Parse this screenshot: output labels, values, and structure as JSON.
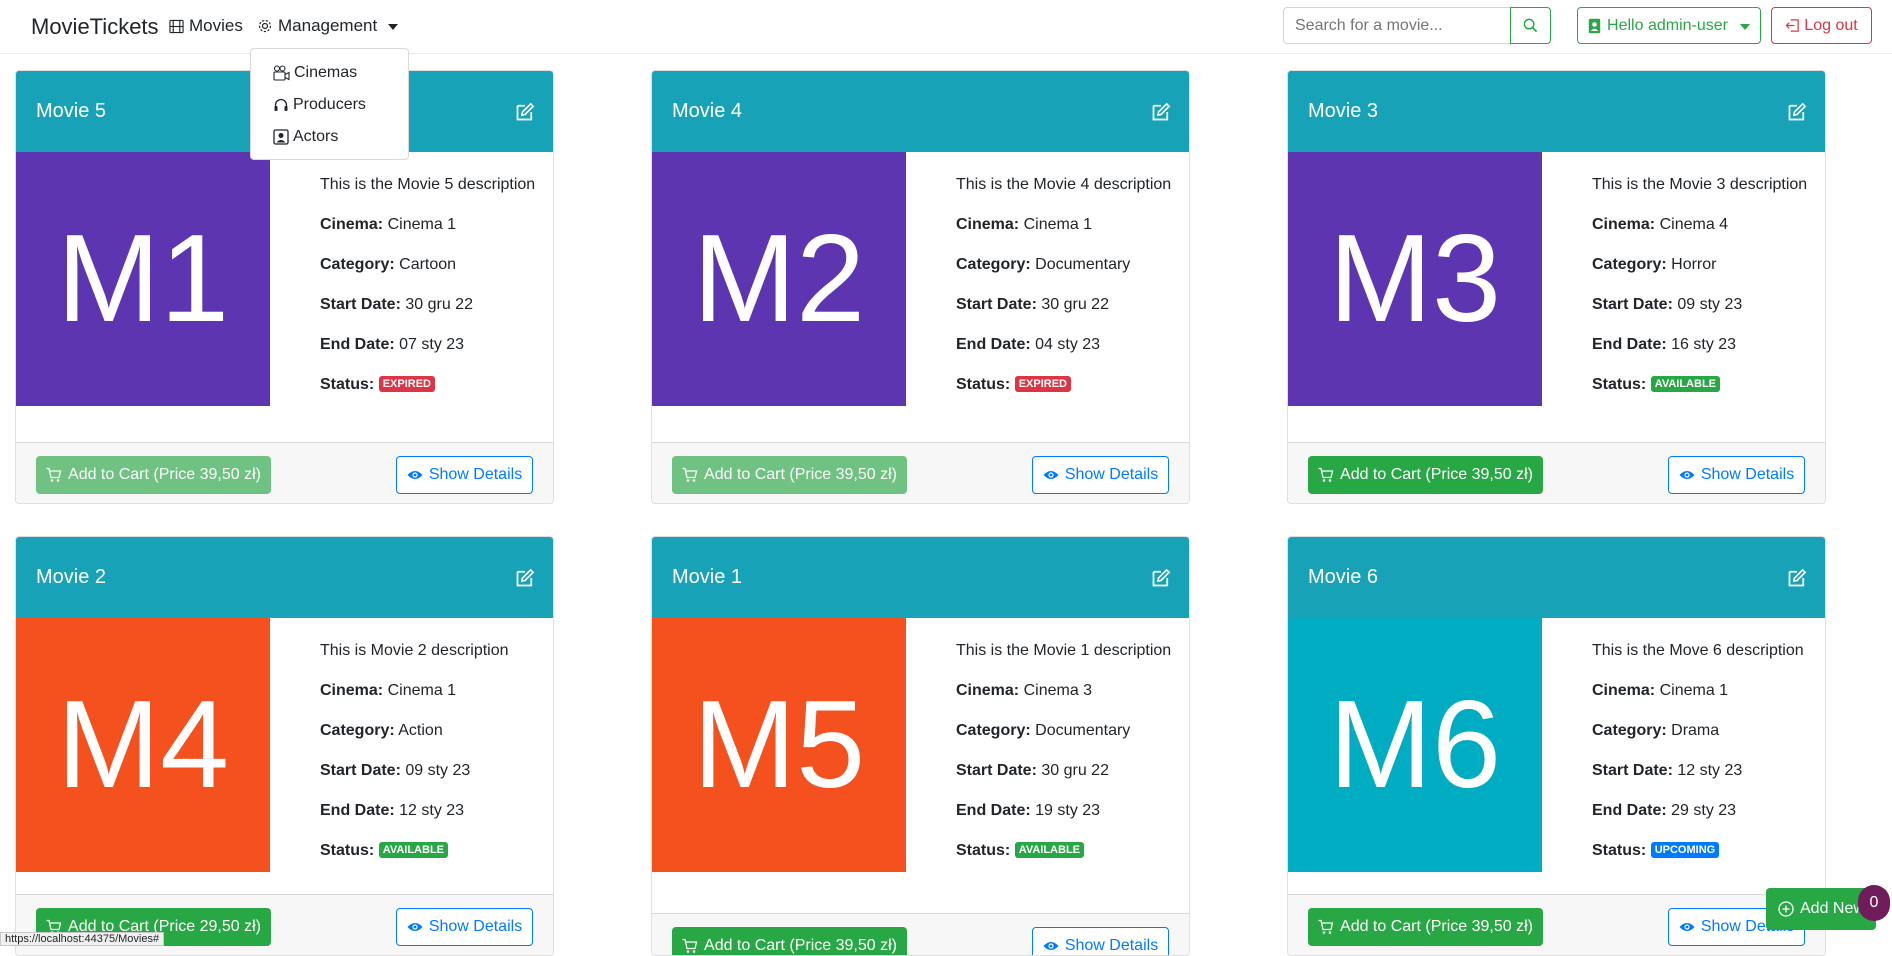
{
  "navbar": {
    "brand": "MovieTickets",
    "movies_label": "Movies",
    "management_label": "Management",
    "search_placeholder": "Search for a movie...",
    "user_label": "Hello admin-user",
    "logout_label": "Log out"
  },
  "management_menu": {
    "items": [
      {
        "label": "Cinemas",
        "icon": "cinema-icon"
      },
      {
        "label": "Producers",
        "icon": "headset-icon"
      },
      {
        "label": "Actors",
        "icon": "person-badge-icon"
      }
    ]
  },
  "movies": [
    {
      "title": "Movie 5",
      "poster": "M1",
      "poster_color": "#5e35b1",
      "description": "This is the Movie 5 description",
      "cinema_label": "Cinema:",
      "cinema": "Cinema 1",
      "category_label": "Category:",
      "category": "Cartoon",
      "start_label": "Start Date:",
      "start": "30 gru 22",
      "end_label": "End Date:",
      "end": "07 sty 23",
      "status_label": "Status:",
      "status": "EXPIRED",
      "status_color": "#dc3545",
      "cart_label": "Add to Cart (Price 39,50 zł)",
      "cart_disabled": true,
      "details_label": "Show Details"
    },
    {
      "title": "Movie 4",
      "poster": "M2",
      "poster_color": "#5e35b1",
      "description": "This is the Movie 4 description",
      "cinema_label": "Cinema:",
      "cinema": "Cinema 1",
      "category_label": "Category:",
      "category": "Documentary",
      "start_label": "Start Date:",
      "start": "30 gru 22",
      "end_label": "End Date:",
      "end": "04 sty 23",
      "status_label": "Status:",
      "status": "EXPIRED",
      "status_color": "#dc3545",
      "cart_label": "Add to Cart (Price 39,50 zł)",
      "cart_disabled": true,
      "details_label": "Show Details"
    },
    {
      "title": "Movie 3",
      "poster": "M3",
      "poster_color": "#5e35b1",
      "description": "This is the Movie 3 description",
      "cinema_label": "Cinema:",
      "cinema": "Cinema 4",
      "category_label": "Category:",
      "category": "Horror",
      "start_label": "Start Date:",
      "start": "09 sty 23",
      "end_label": "End Date:",
      "end": "16 sty 23",
      "status_label": "Status:",
      "status": "AVAILABLE",
      "status_color": "#28a745",
      "cart_label": "Add to Cart (Price 39,50 zł)",
      "cart_disabled": false,
      "details_label": "Show Details"
    },
    {
      "title": "Movie 2",
      "poster": "M4",
      "poster_color": "#f4511e",
      "description": "This is Movie 2 description",
      "cinema_label": "Cinema:",
      "cinema": "Cinema 1",
      "category_label": "Category:",
      "category": "Action",
      "start_label": "Start Date:",
      "start": "09 sty 23",
      "end_label": "End Date:",
      "end": "12 sty 23",
      "status_label": "Status:",
      "status": "AVAILABLE",
      "status_color": "#28a745",
      "cart_label": "Add to Cart (Price 29,50 zł)",
      "cart_disabled": false,
      "details_label": "Show Details"
    },
    {
      "title": "Movie 1",
      "poster": "M5",
      "poster_color": "#f4511e",
      "description": "This is the Movie 1 description",
      "cinema_label": "Cinema:",
      "cinema": "Cinema 3",
      "category_label": "Category:",
      "category": "Documentary",
      "start_label": "Start Date:",
      "start": "30 gru 22",
      "end_label": "End Date:",
      "end": "19 sty 23",
      "status_label": "Status:",
      "status": "AVAILABLE",
      "status_color": "#28a745",
      "cart_label": "Add to Cart (Price 39,50 zł)",
      "cart_disabled": false,
      "details_label": "Show Details"
    },
    {
      "title": "Movie 6",
      "poster": "M6",
      "poster_color": "#00acc1",
      "description": "This is the Move 6 description",
      "cinema_label": "Cinema:",
      "cinema": "Cinema 1",
      "category_label": "Category:",
      "category": "Drama",
      "start_label": "Start Date:",
      "start": "12 sty 23",
      "end_label": "End Date:",
      "end": "29 sty 23",
      "status_label": "Status:",
      "status": "UPCOMING",
      "status_color": "#007bff",
      "cart_label": "Add to Cart (Price 39,50 zł)",
      "cart_disabled": false,
      "details_label": "Show Details"
    }
  ],
  "add_new_label": "Add New",
  "cart_count": "0",
  "status_url": "https://localhost:44375/Movies#"
}
